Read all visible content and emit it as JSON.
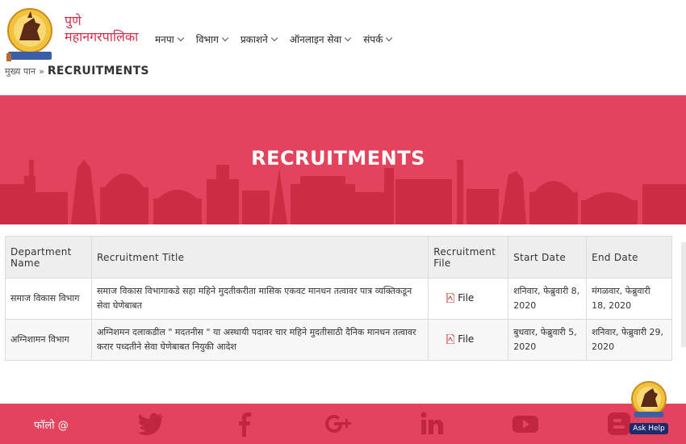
{
  "header": {
    "brand_line1": "पुणे",
    "brand_line2": "महानगरपालिका",
    "logo_icon": "pmc-seal-icon",
    "logo_caption": "पुणे महानगरपालिका"
  },
  "nav": {
    "items": [
      {
        "label": "मनपा"
      },
      {
        "label": "विभाग"
      },
      {
        "label": "प्रकाशने"
      },
      {
        "label": "ऑनलाइन सेवा"
      },
      {
        "label": "संपर्क"
      }
    ]
  },
  "breadcrumb": {
    "home": "मुख्य पान",
    "separator": "»",
    "current": "RECRUITMENTS"
  },
  "banner": {
    "title": "RECRUITMENTS",
    "color": "#e3435c"
  },
  "table": {
    "headers": [
      "Department Name",
      "Recruitment Title",
      "Recruitment File",
      "Start Date",
      "End Date"
    ],
    "rows": [
      {
        "department": "समाज विकास विभाग",
        "title": "समाज विकास विभागाकडे सहा महिने मुदतीकरीता मासिक एकवट मानधन तत्वावर पात्र व्यक्तिकडून सेवा घेणेबाबत",
        "file": "File",
        "start": "शनिवार, फेब्रुवारी 8, 2020",
        "end": "मंगळवार, फेब्रुवारी 18, 2020"
      },
      {
        "department": "अग्निशामन विभाग",
        "title": "अग्निशमन दलाकडील \" मदतनीस \" या अस्थायी पदावर चार महिने मुदतीसाठी दैनिक मानधन तत्वावर करार पध्दतीने सेवा घेणेबाबत नियुकी आदेश",
        "file": "File",
        "start": "बुधवार, फेब्रुवारी 5, 2020",
        "end": "शनिवार, फेब्रुवारी 29, 2020"
      }
    ]
  },
  "footer": {
    "follow_label": "फॉलो @",
    "social": [
      "twitter-icon",
      "facebook-icon",
      "google-plus-icon",
      "linkedin-icon",
      "youtube-icon",
      "blogger-icon"
    ],
    "color": "#e3435c"
  },
  "ask_help": {
    "label": "Ask Help"
  }
}
